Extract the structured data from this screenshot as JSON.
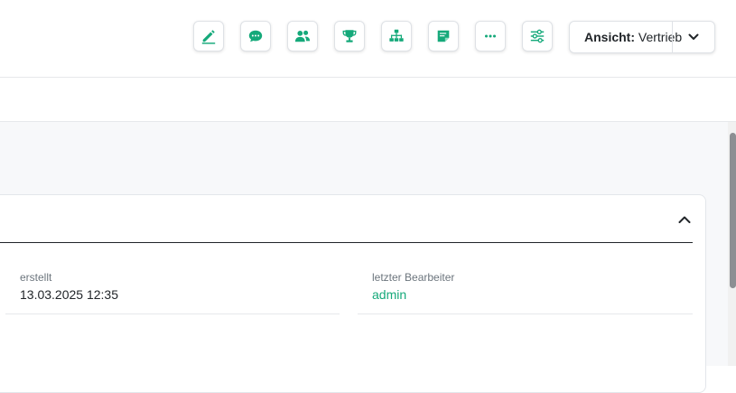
{
  "toolbar": {
    "accent_color": "#15a97a",
    "buttons": [
      {
        "icon": "pen-icon"
      },
      {
        "icon": "chat-bubble-icon"
      },
      {
        "icon": "users-icon"
      },
      {
        "icon": "trophy-icon"
      },
      {
        "icon": "sitemap-icon"
      },
      {
        "icon": "sticky-note-icon"
      },
      {
        "icon": "more-dots-icon"
      },
      {
        "icon": "sliders-icon"
      }
    ],
    "view": {
      "label": "Ansicht:",
      "value": "Vertrieb",
      "icon": "chevron-down-icon"
    }
  },
  "card": {
    "collapse_icon": "chevron-up-icon",
    "fields": {
      "created_label": "erstellt",
      "created_value": "13.03.2025 12:35",
      "last_editor_label": "letzter Bearbeiter",
      "last_editor_value": "admin"
    }
  }
}
